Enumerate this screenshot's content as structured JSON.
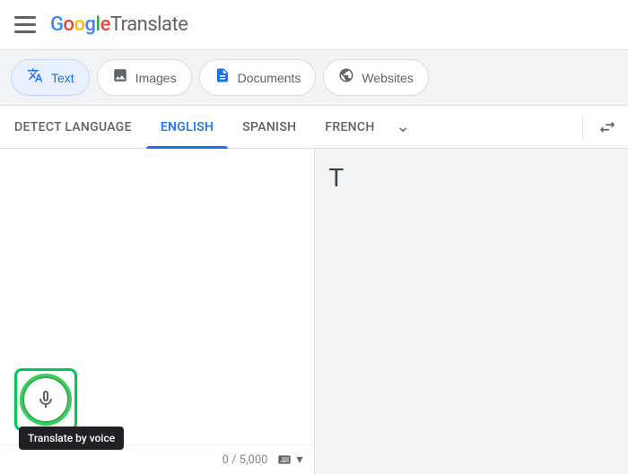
{
  "header": {
    "menu_icon": "hamburger-icon",
    "logo_text": "Google Translate",
    "logo_google": "Google",
    "logo_translate": " Translate"
  },
  "tabs": [
    {
      "id": "text",
      "label": "Text",
      "icon": "translate-icon",
      "active": true
    },
    {
      "id": "images",
      "label": "Images",
      "icon": "image-icon",
      "active": false
    },
    {
      "id": "documents",
      "label": "Documents",
      "icon": "document-icon",
      "active": false
    },
    {
      "id": "websites",
      "label": "Websites",
      "icon": "globe-icon",
      "active": false
    }
  ],
  "language_bar": {
    "detect": "DETECT LANGUAGE",
    "english": "ENGLISH",
    "spanish": "SPANISH",
    "french": "FRENCH",
    "swap_icon": "swap-icon"
  },
  "source_panel": {
    "placeholder": "",
    "char_count": "0 / 5,000",
    "voice_tooltip": "Translate by voice"
  },
  "target_panel": {
    "text": "T"
  },
  "colors": {
    "google_blue": "#4285f4",
    "google_red": "#ea4335",
    "google_yellow": "#fbbc04",
    "google_green": "#34a853",
    "active_blue": "#1a73e8",
    "highlight_green": "#00c853"
  }
}
